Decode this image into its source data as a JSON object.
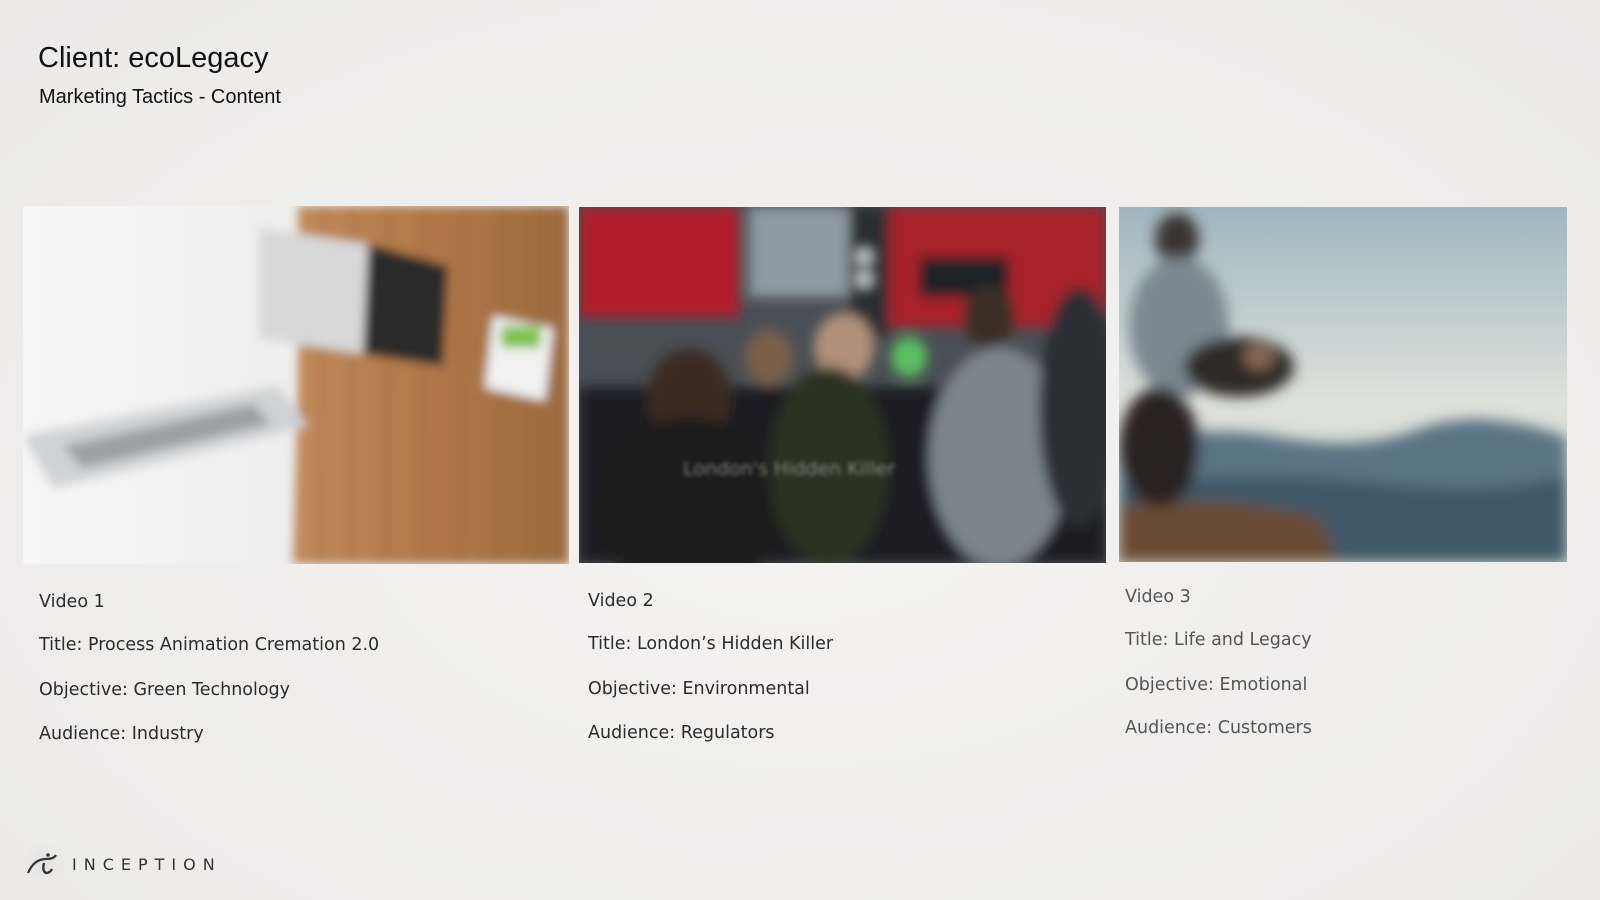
{
  "header": {
    "title": "Client: ecoLegacy",
    "subtitle": "Marketing Tactics - Content"
  },
  "videos": [
    {
      "label": "Video 1",
      "title": "Title: Process Animation Cremation 2.0",
      "objective": "Objective: Green Technology",
      "audience": "Audience: Industry"
    },
    {
      "label": "Video 2",
      "title": "Title: London’s Hidden Killer",
      "objective": "Objective: Environmental",
      "audience": "Audience: Regulators",
      "overlay_text": "London's Hidden Killer"
    },
    {
      "label": "Video 3",
      "title": "Title: Life and Legacy",
      "objective": "Objective: Emotional",
      "audience": "Audience: Customers"
    }
  ],
  "footer": {
    "logo_text": "INCEPTION"
  },
  "icons": {
    "logo": "inception-logo-icon"
  }
}
